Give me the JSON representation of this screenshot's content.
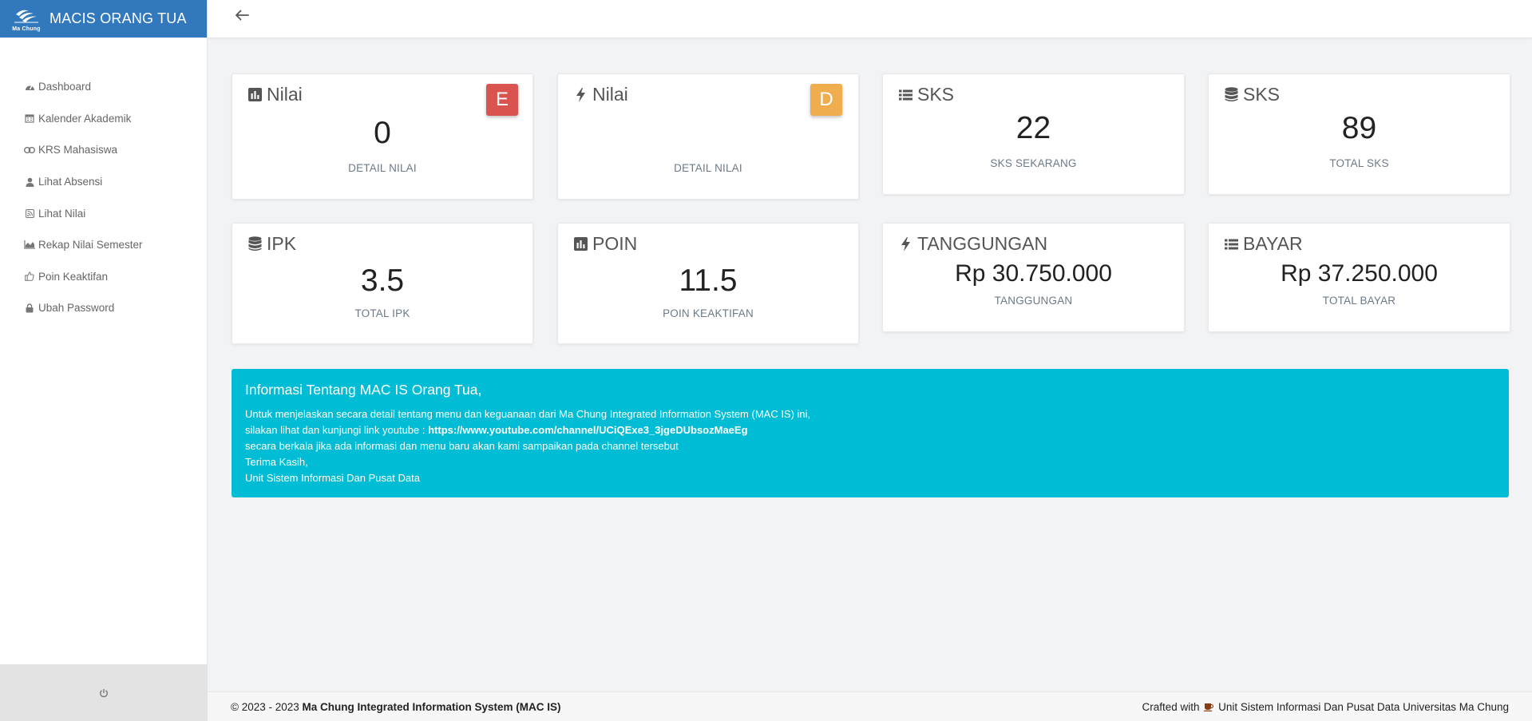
{
  "app": {
    "title": "MACIS ORANG TUA",
    "logo_text": "Ma Chung"
  },
  "sidebar": {
    "items": [
      {
        "label": "Dashboard",
        "icon": "dashboard-icon"
      },
      {
        "label": "Kalender Akademik",
        "icon": "calendar-icon"
      },
      {
        "label": "KRS Mahasiswa",
        "icon": "link-icon"
      },
      {
        "label": "Lihat Absensi",
        "icon": "user-icon"
      },
      {
        "label": "Lihat Nilai",
        "icon": "rss-icon"
      },
      {
        "label": "Rekap Nilai Semester",
        "icon": "area-chart-icon"
      },
      {
        "label": "Poin Keaktifan",
        "icon": "thumbs-up-icon"
      },
      {
        "label": "Ubah Password",
        "icon": "lock-icon"
      }
    ],
    "footer_icon": "power-icon"
  },
  "cards": [
    {
      "title": "Nilai",
      "icon": "bar-chart-icon",
      "value": "0",
      "subtitle": "DETAIL NILAI",
      "badge": "E",
      "badge_color": "#d9534f"
    },
    {
      "title": "Nilai",
      "icon": "bolt-icon",
      "value": "",
      "subtitle": "DETAIL NILAI",
      "badge": "D",
      "badge_color": "#f0ad4e"
    },
    {
      "title": "SKS",
      "icon": "list-icon",
      "value": "22",
      "subtitle": "SKS SEKARANG"
    },
    {
      "title": "SKS",
      "icon": "database-icon",
      "value": "89",
      "subtitle": "TOTAL SKS"
    },
    {
      "title": "IPK",
      "icon": "database-icon",
      "value": "3.5",
      "subtitle": "TOTAL IPK"
    },
    {
      "title": "POIN",
      "icon": "bar-chart-icon",
      "value": "11.5",
      "subtitle": "POIN KEAKTIFAN"
    },
    {
      "title": "TANGGUNGAN",
      "icon": "bolt-icon",
      "value": "Rp 30.750.000",
      "subtitle": "TANGGUNGAN"
    },
    {
      "title": "BAYAR",
      "icon": "list-icon",
      "value": "Rp 37.250.000",
      "subtitle": "TOTAL BAYAR"
    }
  ],
  "info": {
    "title": "Informasi Tentang MAC IS Orang Tua,",
    "line1": "Untuk menjelaskan secara detail tentang menu dan keguanaan dari Ma Chung Integrated Information System (MAC IS) ini,",
    "line2_prefix": "silakan lihat dan kunjungi link youtube : ",
    "link": "https://www.youtube.com/channel/UCiQExe3_3jgeDUbsozMaeEg",
    "line3": "secara berkala jika ada informasi dan menu baru akan kami sampaikan pada channel tersebut",
    "line4": "Terima Kasih,",
    "line5": "Unit Sistem Informasi Dan Pusat Data"
  },
  "footer": {
    "copyright_prefix": "© 2023 - 2023 ",
    "system_name": "Ma Chung Integrated Information System (MAC IS)",
    "crafted_prefix": "Crafted with",
    "crafted_suffix": "Unit Sistem Informasi Dan Pusat Data Universitas Ma Chung"
  },
  "colors": {
    "brand": "#3278bd",
    "info": "#00bcd4",
    "badge_e": "#d9534f",
    "badge_d": "#f0ad4e"
  }
}
